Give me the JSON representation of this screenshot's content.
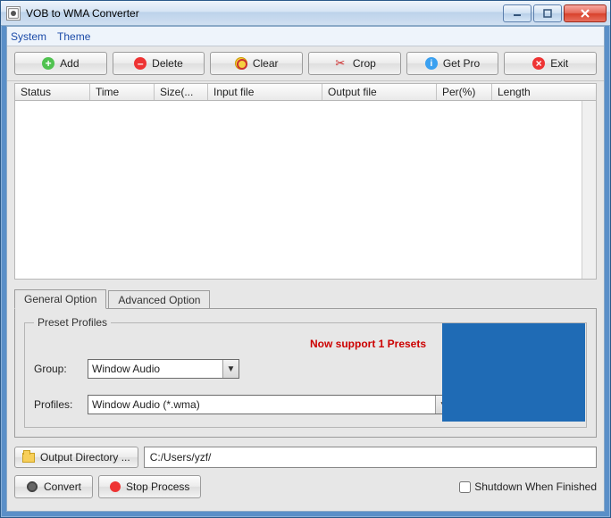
{
  "window": {
    "title": "VOB to WMA Converter"
  },
  "menu": {
    "system": "System",
    "theme": "Theme"
  },
  "toolbar": {
    "add": "Add",
    "delete": "Delete",
    "clear": "Clear",
    "crop": "Crop",
    "getpro": "Get Pro",
    "exit": "Exit"
  },
  "columns": {
    "status": "Status",
    "time": "Time",
    "size": "Size(...",
    "input": "Input file",
    "output": "Output file",
    "per": "Per(%)",
    "length": "Length"
  },
  "tabs": {
    "general": "General Option",
    "advanced": "Advanced Option"
  },
  "preset": {
    "legend": "Preset Profiles",
    "now": "Now support 1 Presets",
    "group_label": "Group:",
    "group_value": "Window Audio",
    "profiles_label": "Profiles:",
    "profiles_value": "Window Audio (*.wma)"
  },
  "output": {
    "button": "Output Directory ...",
    "path": "C:/Users/yzf/"
  },
  "actions": {
    "convert": "Convert",
    "stop": "Stop Process"
  },
  "shutdown_label": "Shutdown When Finished"
}
